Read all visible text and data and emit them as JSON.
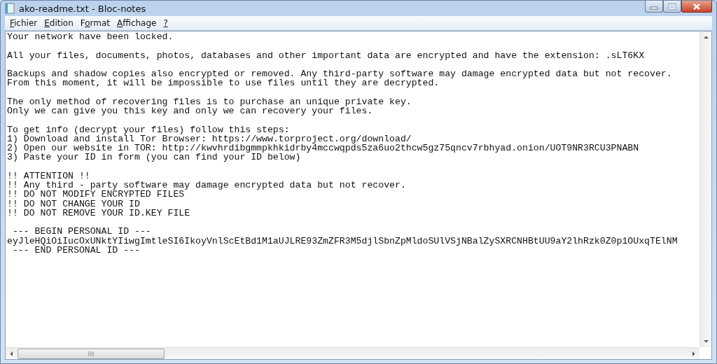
{
  "window": {
    "title": "ako-readme.txt - Bloc-notes"
  },
  "menu": [
    {
      "key": "F",
      "after": "ichier"
    },
    {
      "key": "E",
      "after": "dition"
    },
    {
      "before": "F",
      "key": "o",
      "after": "rmat"
    },
    {
      "key": "A",
      "after": "ffichage"
    },
    {
      "key": "?"
    }
  ],
  "document": {
    "paragraphs": [
      [
        "Your network have been locked."
      ],
      [
        "All your files, documents, photos, databases and other important data are encrypted and have the extension: .sLT6KX"
      ],
      [
        "Backups and shadow copies also encrypted or removed. Any third-party software may damage encrypted data but not recover.",
        "From this moment, it will be impossible to use files until they are decrypted."
      ],
      [
        "The only method of recovering files is to purchase an unique private key.",
        "Only we can give you this key and only we can recovery your files."
      ],
      [
        "To get info (decrypt your files) follow this steps:",
        "1) Download and install Tor Browser: https://www.torproject.org/download/",
        "2) Open our website in TOR: http://kwvhrdibgmmpkhkidrby4mccwqpds5za6uo2thcw5gz75qncv7rbhyad.onion/UOT9NR3RCU3PNABN",
        "3) Paste your ID in form (you can find your ID below)"
      ],
      [
        "!! ATTENTION !!",
        "!! Any third - party software may damage encrypted data but not recover.",
        "!! DO NOT MODIFY ENCRYPTED FILES",
        "!! DO NOT CHANGE YOUR ID",
        "!! DO NOT REMOVE YOUR ID.KEY FILE"
      ],
      [
        " --- BEGIN PERSONAL ID ---",
        "eyJleHQiOiIucOxUNktYIiwgImtleSI6IkoyVnlScEtBd1M1aUJLRE93ZmZFR3M5djlSbnZpMldoSUlVSjNBalZySXRCNHBtUU9aY2lhRzk0Z0p1OUxqTElNM",
        " --- END PERSONAL ID ---"
      ]
    ]
  }
}
